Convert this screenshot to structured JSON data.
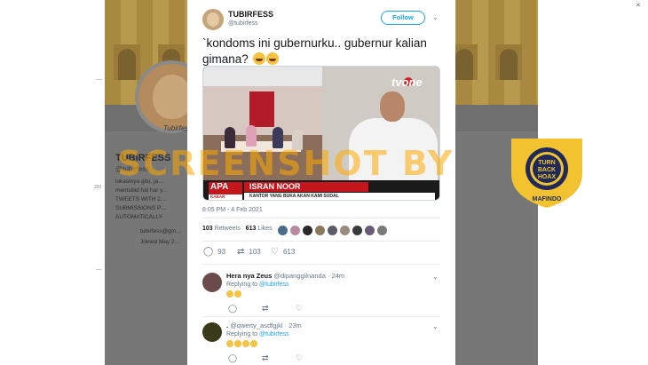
{
  "background_profile": {
    "name": "TUBIRFESS",
    "handle": "@tubirfess",
    "avatar_caption": "Tubirfess",
    "bio": "lokasinya gitu, ja… mentubid hal har y… TWEETS WITH 2… SUBMISSIONS P… AUTOMATICALLY",
    "email": "tubirfess@gm…",
    "joined": "Joined May 2…",
    "side_label": "350"
  },
  "tweet": {
    "author_name": "TUBIRFESS",
    "author_handle": "@tubirfess",
    "follow_label": "Follow",
    "text": "`kondoms ini gubernurku.. gubernur kalian gimana?",
    "timestamp": "8:05 PM - 4 Feb 2021",
    "retweets_count": "103",
    "retweets_label": "Retweets",
    "likes_count": "613",
    "likes_label": "Likes",
    "actions": {
      "reply_count": "93",
      "retweet_count": "103",
      "like_count": "613"
    },
    "media": {
      "channel_logo": "tvone",
      "program_badge": "APA",
      "program_badge_sub": "KABAR",
      "person_name": "ISRAN NOOR",
      "person_title": "KANTOR YANG BUKA AKAN KAMI SUDAL"
    }
  },
  "replies": [
    {
      "name": "Hera nya Zeus",
      "handle": "@dipanggilnanda",
      "time": "24m",
      "replying_prefix": "Replying to",
      "replying_to": "@tubirfess"
    },
    {
      "name": ".",
      "handle": "@qwerty_asdfgjkl",
      "time": "23m",
      "replying_prefix": "Replying to",
      "replying_to": "@tubirfess"
    }
  ],
  "watermark": {
    "text": "SCREENSHOT BY",
    "seal_top": "MASYARAKAT ANTI FITNAH INDONESIA",
    "seal_center": "TURN BACK HOAX",
    "seal_bottom": "MAFINDO"
  },
  "colors": {
    "twitter_blue": "#1da1f2",
    "watermark_orange": "#ffaa00",
    "seal_yellow": "#f2c230",
    "seal_navy": "#1f2a5a"
  }
}
